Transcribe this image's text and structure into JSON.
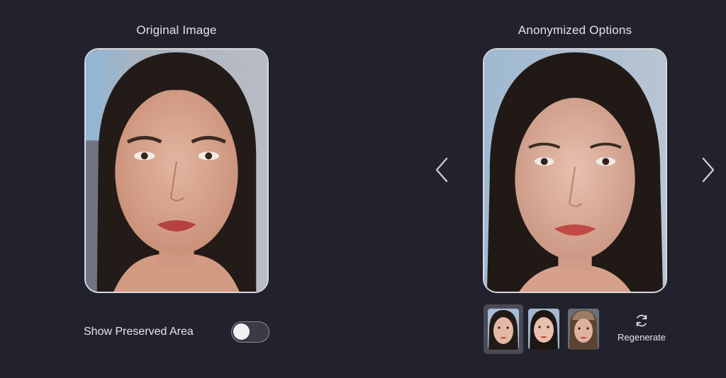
{
  "original_panel": {
    "title": "Original Image"
  },
  "anonymized_panel": {
    "title": "Anonymized Options"
  },
  "preserved_area_toggle": {
    "label": "Show Preserved Area",
    "on": false
  },
  "variants": {
    "selected_index": 0,
    "regenerate_label": "Regenerate"
  },
  "icons": {
    "prev": "chevron-left-icon",
    "next": "chevron-right-icon",
    "regenerate": "refresh-icon"
  },
  "colors": {
    "background": "#21222d",
    "frame_border": "#d9d9de",
    "selected_thumb_bg": "#4a4b57"
  }
}
